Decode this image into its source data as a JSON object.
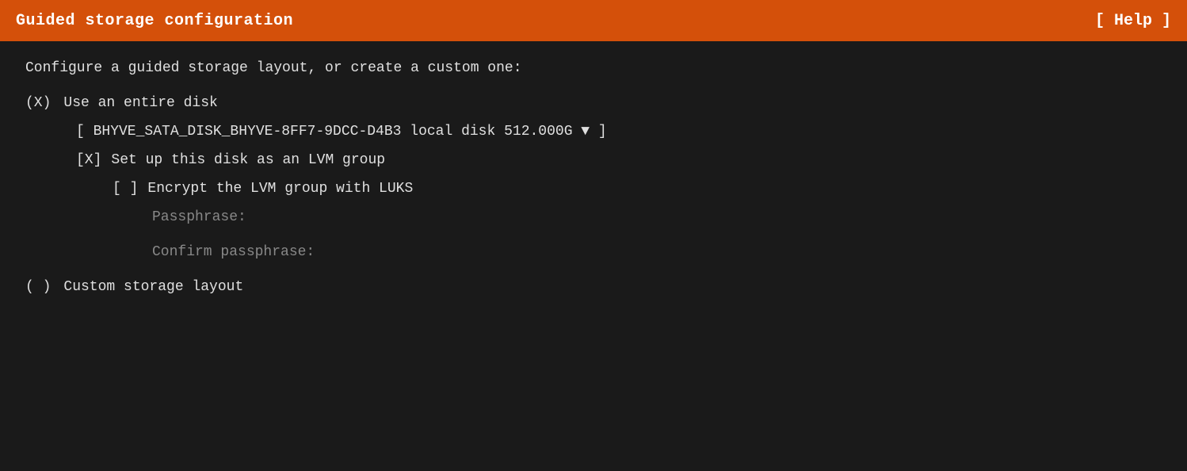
{
  "titleBar": {
    "title": "Guided storage configuration",
    "helpButton": "[ Help ]"
  },
  "description": "Configure a guided storage layout, or create a custom one:",
  "options": {
    "useEntireDisk": {
      "radio": "(X)",
      "label": "Use an entire disk"
    },
    "diskSelector": "[ BHYVE_SATA_DISK_BHYVE-8FF7-9DCC-D4B3 local disk 512.000G ▼ ]",
    "lvmGroup": {
      "checkbox": "[X]",
      "label": "Set up this disk as an LVM group"
    },
    "encryptLuks": {
      "checkbox": "[ ]",
      "label": "Encrypt the LVM group with LUKS"
    },
    "passphrase": {
      "label": "Passphrase:",
      "value": ""
    },
    "confirmPassphrase": {
      "label": "Confirm passphrase:",
      "value": ""
    },
    "customLayout": {
      "radio": "( )",
      "label": "Custom storage layout"
    }
  }
}
